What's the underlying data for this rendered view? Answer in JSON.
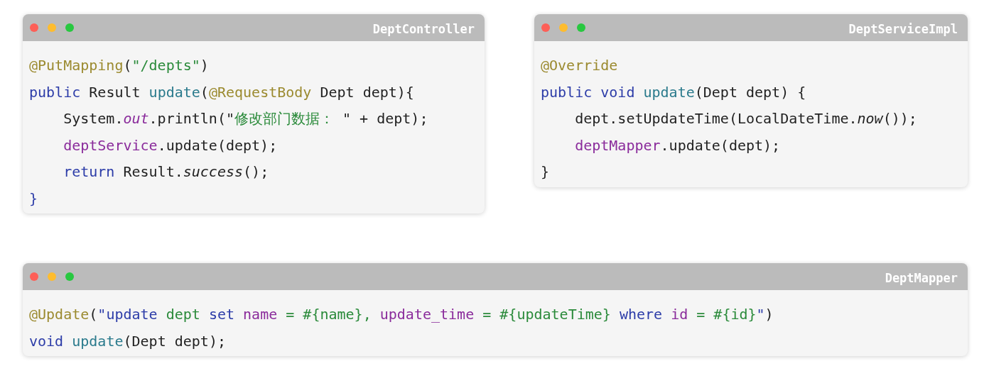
{
  "panels": [
    {
      "title": "DeptController",
      "lines": [
        [
          {
            "kind": "annotation",
            "text": "@PutMapping"
          },
          {
            "kind": "plain",
            "text": "("
          },
          {
            "kind": "string",
            "text": "\"/depts\""
          },
          {
            "kind": "plain",
            "text": ")"
          }
        ],
        [
          {
            "kind": "keyword",
            "text": "public "
          },
          {
            "kind": "plain",
            "text": "Result "
          },
          {
            "kind": "method",
            "text": "update"
          },
          {
            "kind": "plain",
            "text": "("
          },
          {
            "kind": "annotation",
            "text": "@RequestBody"
          },
          {
            "kind": "plain",
            "text": " Dept dept){"
          }
        ],
        [
          {
            "kind": "plain",
            "text": "    System."
          },
          {
            "kind": "static_field",
            "text": "out"
          },
          {
            "kind": "plain",
            "text": ".println(\""
          },
          {
            "kind": "string",
            "text": "修改部门数据："
          },
          {
            "kind": "plain",
            "text": " \" + dept);"
          }
        ],
        [
          {
            "kind": "field",
            "text": "    deptService"
          },
          {
            "kind": "plain",
            "text": ".update(dept);"
          }
        ],
        [
          {
            "kind": "keyword",
            "text": "    return "
          },
          {
            "kind": "plain",
            "text": "Result."
          },
          {
            "kind": "static_call",
            "text": "success"
          },
          {
            "kind": "plain",
            "text": "();"
          }
        ],
        [
          {
            "kind": "keyword",
            "text": "}"
          }
        ]
      ]
    },
    {
      "title": "DeptServiceImpl",
      "lines": [
        [
          {
            "kind": "annotation",
            "text": "@Override"
          }
        ],
        [
          {
            "kind": "keyword",
            "text": "public void "
          },
          {
            "kind": "method",
            "text": "update"
          },
          {
            "kind": "plain",
            "text": "(Dept dept) {"
          }
        ],
        [
          {
            "kind": "plain",
            "text": "    dept.setUpdateTime(LocalDateTime."
          },
          {
            "kind": "static_call",
            "text": "now"
          },
          {
            "kind": "plain",
            "text": "());"
          }
        ],
        [
          {
            "kind": "field",
            "text": "    deptMapper"
          },
          {
            "kind": "plain",
            "text": ".update(dept);"
          }
        ],
        [
          {
            "kind": "plain",
            "text": "}"
          }
        ]
      ]
    },
    {
      "title": "DeptMapper",
      "lines": [
        [
          {
            "kind": "annotation",
            "text": "@Update"
          },
          {
            "kind": "plain",
            "text": "("
          },
          {
            "kind": "keyword",
            "text": "\"update "
          },
          {
            "kind": "string",
            "text": "dept "
          },
          {
            "kind": "keyword",
            "text": "set "
          },
          {
            "kind": "field",
            "text": "name "
          },
          {
            "kind": "string",
            "text": "= #{name}, "
          },
          {
            "kind": "field",
            "text": "update_time "
          },
          {
            "kind": "string",
            "text": "= #{updateTime} "
          },
          {
            "kind": "keyword",
            "text": "where "
          },
          {
            "kind": "field",
            "text": "id "
          },
          {
            "kind": "string",
            "text": "= #{id}"
          },
          {
            "kind": "keyword",
            "text": "\""
          },
          {
            "kind": "plain",
            "text": ")"
          }
        ],
        [
          {
            "kind": "keyword",
            "text": "void "
          },
          {
            "kind": "method",
            "text": "update"
          },
          {
            "kind": "plain",
            "text": "(Dept dept);"
          }
        ]
      ]
    }
  ]
}
